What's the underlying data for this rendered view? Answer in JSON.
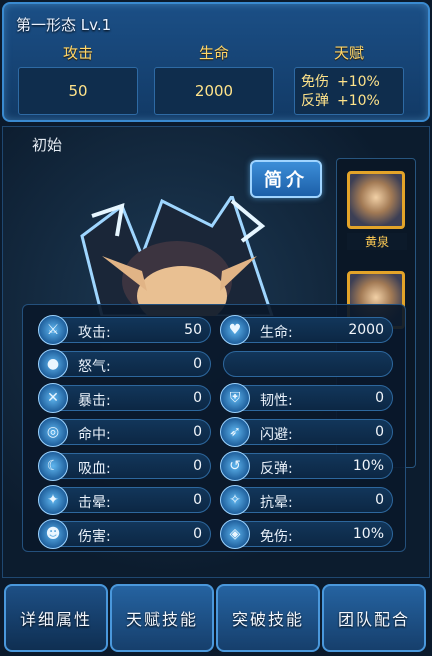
{
  "header": {
    "title": "第一形态 Lv.1",
    "attack_label": "攻击",
    "attack_value": "50",
    "hp_label": "生命",
    "hp_value": "2000",
    "talent_label": "天赋",
    "talents": [
      {
        "name": "免伤",
        "value": "+10%"
      },
      {
        "name": "反弹",
        "value": "+10%"
      }
    ]
  },
  "main": {
    "state_label": "初始",
    "intro_button": "简介"
  },
  "side_list": {
    "items": [
      {
        "name": "黄泉"
      },
      {
        "name": ""
      }
    ]
  },
  "attributes": {
    "left": [
      {
        "icon": "sword-icon",
        "label": "攻击:",
        "value": "50"
      },
      {
        "icon": "orb-icon",
        "label": "怒气:",
        "value": "0"
      },
      {
        "icon": "crossed-blades-icon",
        "label": "暴击:",
        "value": "0"
      },
      {
        "icon": "target-icon",
        "label": "命中:",
        "value": "0"
      },
      {
        "icon": "fang-icon",
        "label": "吸血:",
        "value": "0"
      },
      {
        "icon": "stun-icon",
        "label": "击晕:",
        "value": "0"
      },
      {
        "icon": "mask-icon",
        "label": "伤害:",
        "value": "0"
      }
    ],
    "right": [
      {
        "icon": "heart-icon",
        "label": "生命:",
        "value": "2000"
      },
      {
        "icon": "",
        "label": "",
        "value": ""
      },
      {
        "icon": "armor-icon",
        "label": "韧性:",
        "value": "0"
      },
      {
        "icon": "dodge-icon",
        "label": "闪避:",
        "value": "0"
      },
      {
        "icon": "reflect-icon",
        "label": "反弹:",
        "value": "10%"
      },
      {
        "icon": "resist-stun-icon",
        "label": "抗晕:",
        "value": "0"
      },
      {
        "icon": "shield-icon",
        "label": "免伤:",
        "value": "10%"
      }
    ]
  },
  "tabs": [
    {
      "label": "详细属性"
    },
    {
      "label": "天赋技能"
    },
    {
      "label": "突破技能"
    },
    {
      "label": "团队配合"
    }
  ]
}
